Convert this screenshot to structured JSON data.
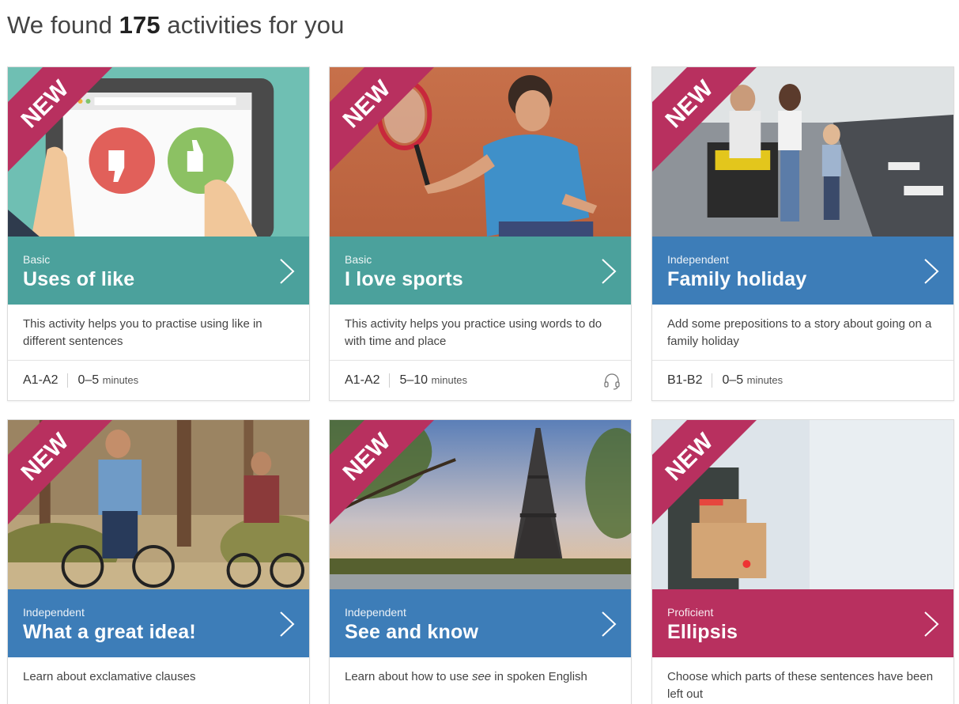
{
  "results": {
    "prefix": "We found ",
    "count": "175",
    "suffix": " activities for you"
  },
  "ribbon_label": "NEW",
  "colors": {
    "basic": "#4ba19c",
    "independent": "#3d7db8",
    "proficient": "#b8305f",
    "ribbon": "#b8305f"
  },
  "cards": [
    {
      "level": "Basic",
      "title": "Uses of like",
      "description": "This activity helps you to practise using like in different sentences",
      "cefr": "A1-A2",
      "duration": "0–5",
      "unit": "minutes"
    },
    {
      "level": "Basic",
      "title": "I love sports",
      "description": "This activity helps you practice using words to do with time and place",
      "cefr": "A1-A2",
      "duration": "5–10",
      "unit": "minutes",
      "icon": "headphones-icon"
    },
    {
      "level": "Independent",
      "title": "Family holiday",
      "description": "Add some prepositions to a story about going on a family holiday",
      "cefr": "B1-B2",
      "duration": "0–5",
      "unit": "minutes"
    },
    {
      "level": "Independent",
      "title": "What a great idea!",
      "description": "Learn about exclamative clauses"
    },
    {
      "level": "Independent",
      "title": "See and know",
      "description_before": "Learn about how to use ",
      "description_em": "see",
      "description_after": " in spoken English"
    },
    {
      "level": "Proficient",
      "title": "Ellipsis",
      "description": "Choose which parts of these sentences have been left out"
    }
  ]
}
